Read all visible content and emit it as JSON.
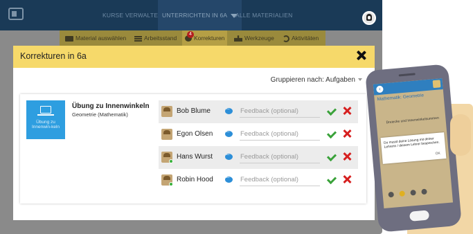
{
  "topnav": {
    "items": [
      "KURSE VERWALTEN",
      "UNTERRICHTEN IN 6A",
      "ALLE MATERIALIEN"
    ]
  },
  "subnav": {
    "tabs": [
      "Material auswählen",
      "Arbeitsstand",
      "Korrekturen",
      "Werkzeuge",
      "Aktivitäten"
    ],
    "badge": "4"
  },
  "modal": {
    "title": "Korrekturen in 6a",
    "group_label": "Gruppieren nach: Aufgaben",
    "task": {
      "tile_label": "Übung zu Innenwin-keln",
      "title": "Übung zu Innenwinkeln",
      "subtitle": "Geometrie (Mathematik)"
    },
    "students": [
      {
        "name": "Bob Blume",
        "placeholder": "Feedback (optional)",
        "online": false
      },
      {
        "name": "Egon Olsen",
        "placeholder": "Feedback (optional)",
        "online": false
      },
      {
        "name": "Hans Wurst",
        "placeholder": "Feedback (optional)",
        "online": true
      },
      {
        "name": "Robin Hood",
        "placeholder": "Feedback (optional)",
        "online": true
      }
    ]
  },
  "phone": {
    "title": "Mathematik: Geometrie",
    "item": "Dreiecke und Innenwinkelsummen",
    "dialog_text": "Du musst deine Lösung mit deiner Lehrerin / deinem Lehrer besprechen.",
    "ok": "OK"
  },
  "colors": {
    "topbar": "#1a3a57",
    "subnav": "#9a8a3c",
    "modal_header": "#f6d96a",
    "tile": "#2e9ee0",
    "accept": "#3aa23a",
    "reject": "#d61f1f"
  }
}
